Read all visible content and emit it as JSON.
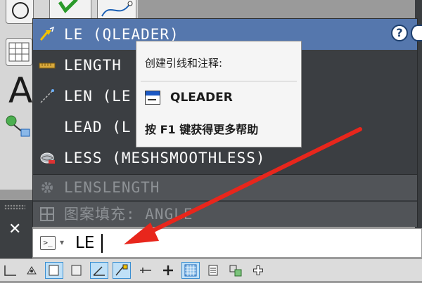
{
  "autocomplete": {
    "items": [
      {
        "label": "LE (QLEADER)",
        "icon": "qleader-icon",
        "state": "selected"
      },
      {
        "label": "LENGTH",
        "icon": "length-icon",
        "state": "normal"
      },
      {
        "label": "LEN (LE",
        "icon": "len-icon",
        "state": "normal"
      },
      {
        "label": "LEAD (L",
        "icon": "",
        "state": "normal"
      },
      {
        "label": "LESS (MESHSMOOTHLESS)",
        "icon": "meshsmoothless-icon",
        "state": "normal"
      },
      {
        "label": "LENSLENGTH",
        "icon": "gear-icon",
        "state": "dimmed"
      },
      {
        "label": "图案填充: ANGLE",
        "icon": "hatch-icon",
        "state": "dimmed"
      }
    ]
  },
  "tooltip": {
    "description": "创建引线和注释:",
    "command": "QLEADER",
    "help_hint": "按 F1 键获得更多帮助"
  },
  "help_button": {
    "label": "?"
  },
  "left_panel": {
    "glyph": "A",
    "close_label": "✕"
  },
  "command_line": {
    "value": "LE",
    "prompt_icon_text": ">_"
  },
  "colors": {
    "selected": "#5577ad",
    "list_bg": "#3b3e42",
    "arrow": "#e8261c",
    "status_active": "#bfe0f7"
  }
}
